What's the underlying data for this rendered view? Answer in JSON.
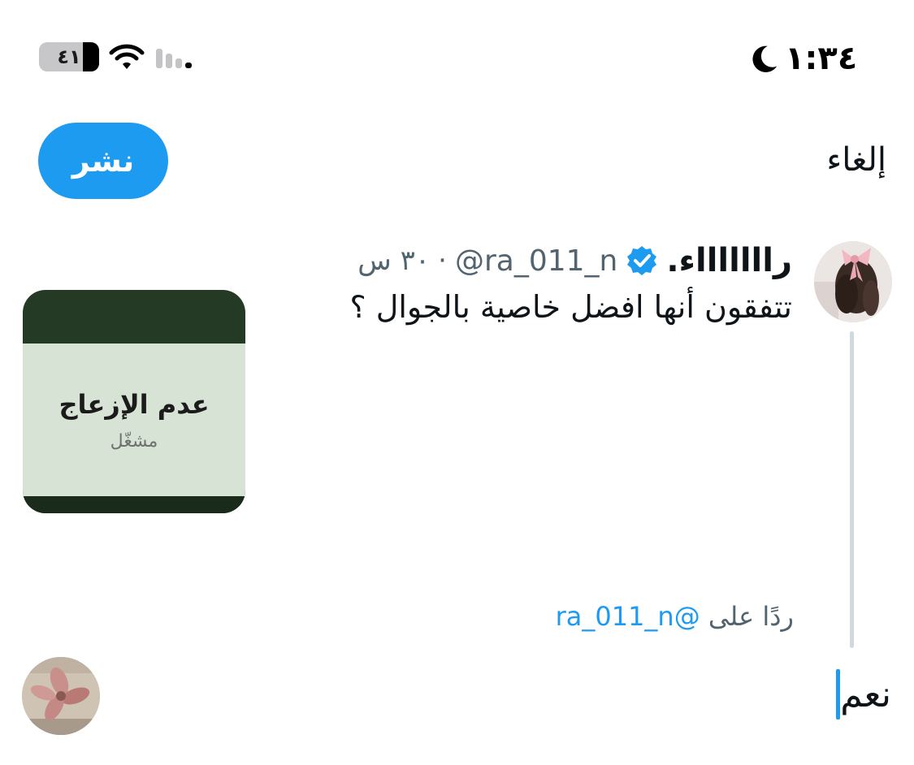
{
  "status_bar": {
    "time": "١:٣٤",
    "battery_label": "٤١",
    "battery_level_percent": 41,
    "moon_icon": "moon-icon",
    "wifi_icon": "wifi-icon",
    "signal_icon": "cellular-signal-icon"
  },
  "header": {
    "cancel_label": "إلغاء",
    "post_label": "نشر"
  },
  "tweet": {
    "display_name": "راااااااء.",
    "handle": "@ra_011_n",
    "separator": "·",
    "time_ago": "٣٠ س",
    "text": "تتفقون أنها افضل خاصية بالجوال ؟",
    "verified_icon": "verified-badge-icon",
    "media": {
      "title": "عدم الإزعاج",
      "subtitle": "مشغّل"
    }
  },
  "reply": {
    "replying_prefix": "ردًا على",
    "replying_handle": "@ra_011_n",
    "text": "نعم"
  },
  "colors": {
    "accent": "#1d9bf0",
    "text_primary": "#0f1419",
    "text_secondary": "#536471",
    "thread_line": "#cfd9de"
  }
}
